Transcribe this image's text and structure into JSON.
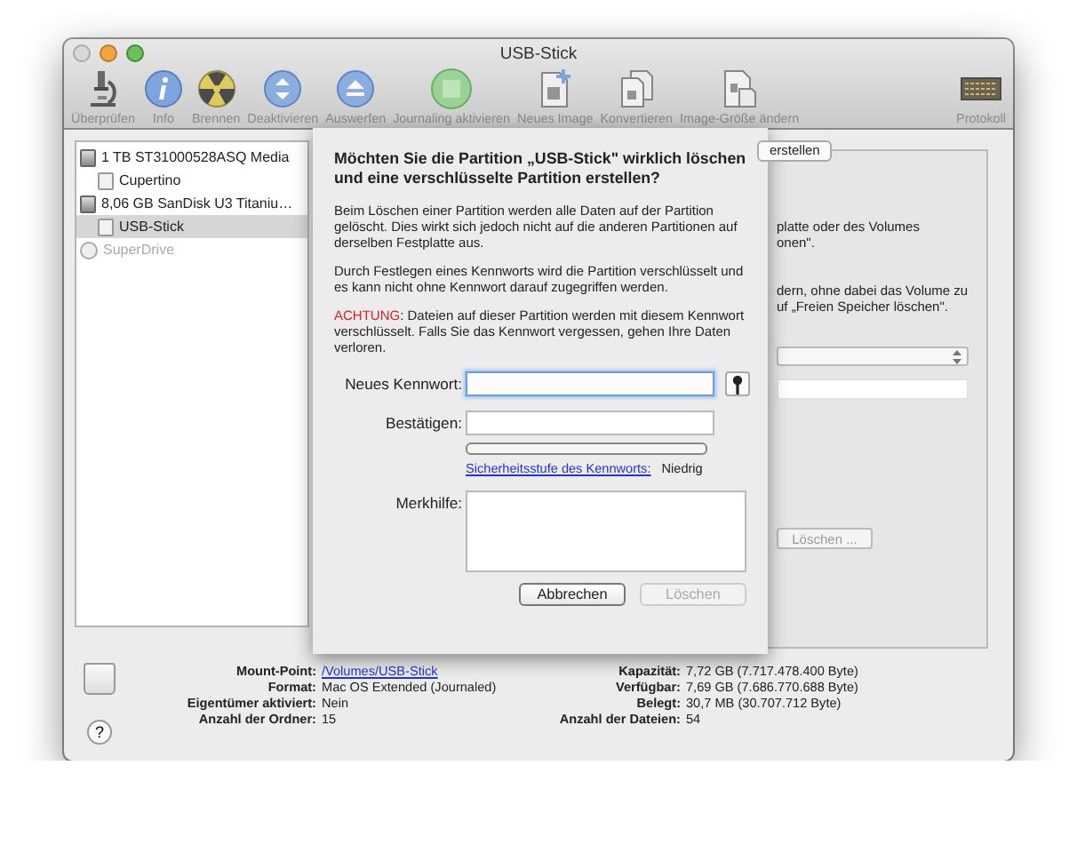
{
  "window": {
    "title": "USB-Stick"
  },
  "toolbar": [
    {
      "label": "Überprüfen"
    },
    {
      "label": "Info"
    },
    {
      "label": "Brennen"
    },
    {
      "label": "Deaktivieren"
    },
    {
      "label": "Auswerfen"
    },
    {
      "label": "Journaling aktivieren"
    },
    {
      "label": "Neues Image"
    },
    {
      "label": "Konvertieren"
    },
    {
      "label": "Image-Größe ändern"
    },
    {
      "label": "Protokoll"
    }
  ],
  "sidebar": {
    "items": [
      {
        "label": "1 TB ST31000528ASQ Media",
        "selected": false,
        "disabled": false,
        "children": [
          {
            "label": "Cupertino",
            "selected": false,
            "disabled": false
          }
        ]
      },
      {
        "label": "8,06 GB SanDisk U3 Titaniu…",
        "selected": false,
        "disabled": false,
        "children": [
          {
            "label": "USB-Stick",
            "selected": true,
            "disabled": false
          }
        ]
      },
      {
        "label": "SuperDrive",
        "selected": false,
        "disabled": true
      }
    ]
  },
  "pane": {
    "tab": "erstellen",
    "texts": [
      "platte oder des Volumes",
      "onen\".",
      "dern, ohne dabei das Volume zu",
      "uf „Freien Speicher löschen\"."
    ],
    "button": "Löschen ..."
  },
  "sheet": {
    "title": "Möchten Sie die Partition „USB-Stick\" wirklich löschen und eine verschlüsselte Partition erstellen?",
    "paragraphs": [
      "Beim Löschen einer Partition werden alle Daten auf der Partition gelöscht. Dies wirkt sich jedoch nicht auf die anderen Partitionen auf derselben Festplatte aus.",
      "Durch Festlegen eines Kennworts wird die Partition verschlüsselt und es kann nicht ohne Kennwort darauf zugegriffen werden."
    ],
    "warning_label": "ACHTUNG",
    "warning_text": ": Dateien auf dieser Partition werden mit diesem Kennwort verschlüsselt. Falls Sie das Kennwort vergessen, gehen Ihre Daten verloren.",
    "new_password_label": "Neues Kennwort:",
    "confirm_label": "Bestätigen:",
    "strength": {
      "level": 0,
      "link": "Sicherheitsstufe des Kennworts:",
      "value": "Niedrig"
    },
    "hint_label": "Merkhilfe:",
    "buttons": [
      {
        "label": "Abbrechen",
        "default": true,
        "disabled": false
      },
      {
        "label": "Löschen",
        "default": false,
        "disabled": true
      }
    ]
  },
  "info": {
    "left": [
      {
        "label": "Mount-Point:",
        "value": "/Volumes/USB-Stick",
        "link": true
      },
      {
        "label": "Format:",
        "value": "Mac OS Extended (Journaled)",
        "link": false
      },
      {
        "label": "Eigentümer aktiviert:",
        "value": "Nein",
        "link": false
      },
      {
        "label": "Anzahl der Ordner:",
        "value": "15",
        "link": false
      }
    ],
    "right": [
      {
        "label": "Kapazität:",
        "value": "7,72 GB (7.717.478.400 Byte)",
        "link": false
      },
      {
        "label": "Verfügbar:",
        "value": "7,69 GB (7.686.770.688 Byte)",
        "link": false
      },
      {
        "label": "Belegt:",
        "value": "30,7 MB (30.707.712 Byte)",
        "link": false
      },
      {
        "label": "Anzahl der Dateien:",
        "value": "54",
        "link": false
      }
    ],
    "help": "?"
  }
}
